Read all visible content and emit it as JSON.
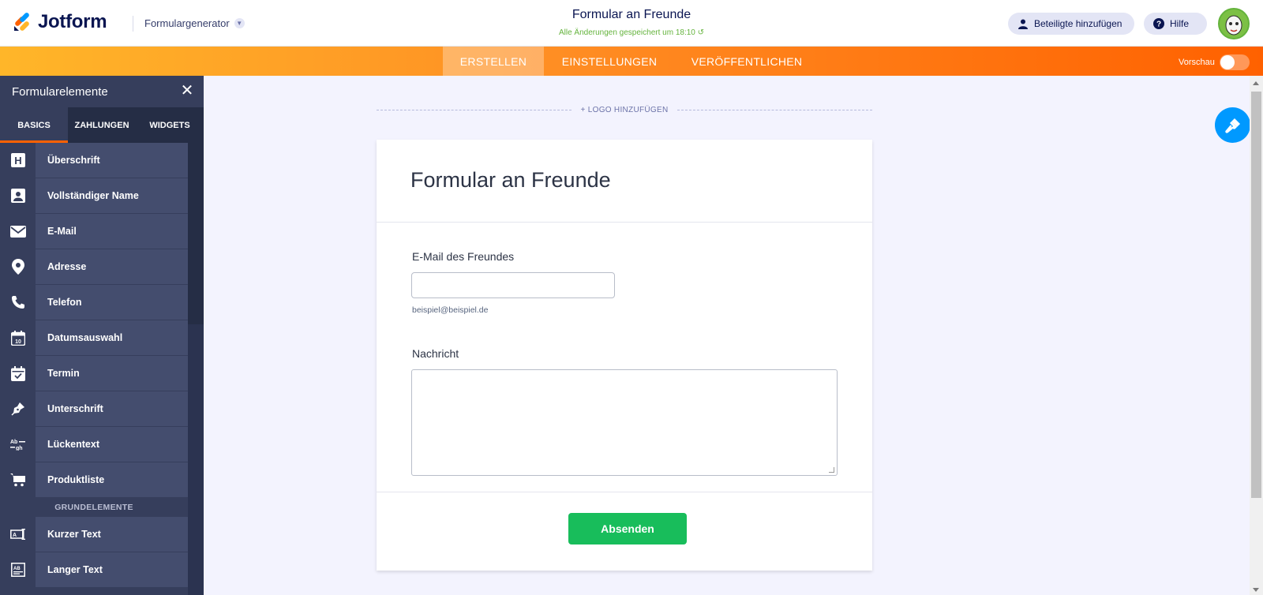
{
  "header": {
    "logo_text": "Jotform",
    "form_generator": "Formulargenerator",
    "form_title": "Formular an Freunde",
    "saved_status": "Alle Änderungen gespeichert um 18:10",
    "add_participants": "Beteiligte hinzufügen",
    "help": "Hilfe"
  },
  "nav": {
    "tabs": [
      "ERSTELLEN",
      "EINSTELLUNGEN",
      "VERÖFFENTLICHEN"
    ],
    "active_tab": "ERSTELLEN",
    "preview_label": "Vorschau",
    "preview_on": false
  },
  "sidebar": {
    "title": "Formularelemente",
    "tabs": [
      "BASICS",
      "ZAHLUNGEN",
      "WIDGETS"
    ],
    "active_tab": "BASICS",
    "items": [
      {
        "label": "Überschrift",
        "icon": "heading-icon"
      },
      {
        "label": "Vollständiger Name",
        "icon": "contact-card-icon"
      },
      {
        "label": "E-Mail",
        "icon": "envelope-icon"
      },
      {
        "label": "Adresse",
        "icon": "map-pin-icon"
      },
      {
        "label": "Telefon",
        "icon": "phone-icon"
      },
      {
        "label": "Datumsauswahl",
        "icon": "calendar-date-icon"
      },
      {
        "label": "Termin",
        "icon": "calendar-check-icon"
      },
      {
        "label": "Unterschrift",
        "icon": "pen-nib-icon"
      },
      {
        "label": "Lückentext",
        "icon": "fill-blank-icon"
      },
      {
        "label": "Produktliste",
        "icon": "cart-icon"
      }
    ],
    "group_title": "GRUNDELEMENTE",
    "group_items": [
      {
        "label": "Kurzer Text",
        "icon": "short-text-icon"
      },
      {
        "label": "Langer Text",
        "icon": "long-text-icon"
      }
    ]
  },
  "canvas": {
    "add_logo": "+ LOGO HINZUFÜGEN",
    "form_heading": "Formular an Freunde",
    "email_label": "E-Mail des Freundes",
    "email_value": "",
    "email_sublabel": "beispiel@beispiel.de",
    "message_label": "Nachricht",
    "message_value": "",
    "submit_label": "Absenden"
  },
  "colors": {
    "accent_orange": "#ff6100",
    "submit_green": "#18bd5b",
    "sidebar_bg": "#363e5c",
    "paint_blue": "#0099ff"
  }
}
